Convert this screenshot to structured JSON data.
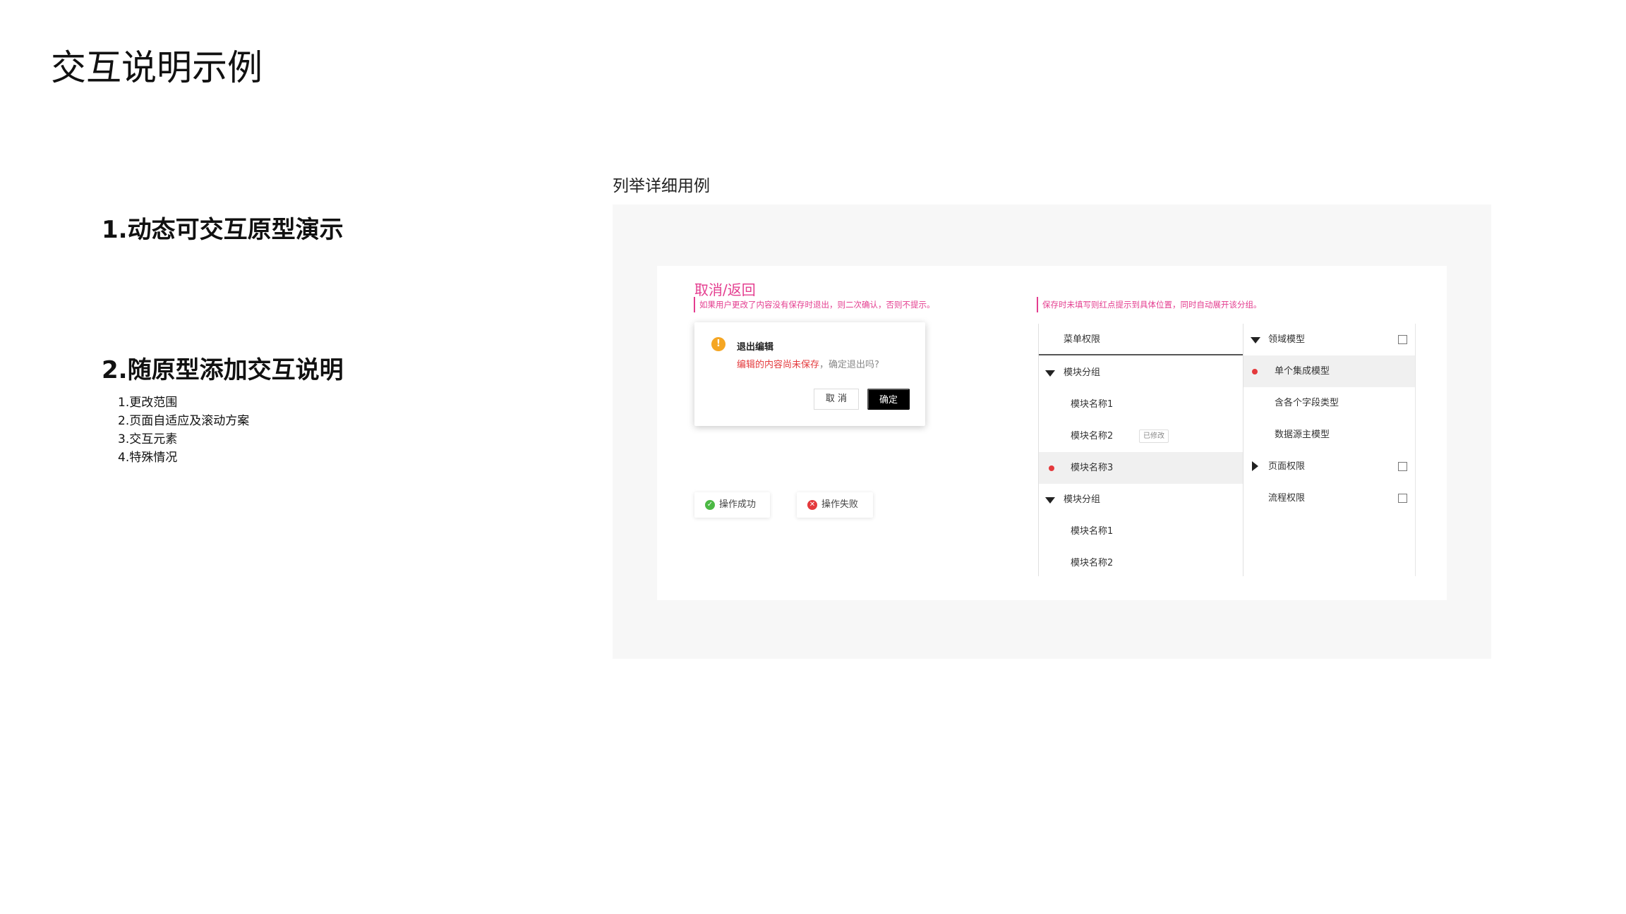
{
  "page": {
    "title": "交互说明示例"
  },
  "sections": {
    "s1": {
      "title": "1.动态可交互原型演示"
    },
    "s2": {
      "title": "2.随原型添加交互说明",
      "items": [
        "1.更改范围",
        "2.页面自适应及滚动方案",
        "3.交互元素",
        "4.特殊情况"
      ]
    }
  },
  "example": {
    "label": "列举详细用例",
    "annotation_title": "取消/返回",
    "note_left": "如果用户更改了内容没有保存时退出，则二次确认，否则不提示。",
    "note_right": "保存时未填写则红点提示到具体位置，同时自动展开该分组。",
    "dialog": {
      "icon": "!",
      "title": "退出编辑",
      "message_red": "编辑的内容尚未保存",
      "message_gray": "，确定退出吗?",
      "cancel_label": "取 消",
      "ok_label": "确定"
    },
    "toasts": {
      "success_label": "操作成功",
      "fail_label": "操作失败"
    },
    "tree_left": {
      "header": "菜单权限",
      "group1": "模块分组",
      "g1_item1": "模块名称1",
      "g1_item2": "模块名称2",
      "g1_item2_badge": "已修改",
      "g1_item3": "模块名称3",
      "group2": "模块分组",
      "g2_item1": "模块名称1",
      "g2_item2": "模块名称2"
    },
    "tree_right": {
      "domain_model": "领域模型",
      "single_model": "单个集成模型",
      "multi_field_type": "含各个字段类型",
      "data_source_model": "数据源主模型",
      "page_permission": "页面权限",
      "flow_permission": "流程权限"
    }
  },
  "colors": {
    "annotation": "#e43d8f",
    "error_dot": "#e4393c",
    "warning": "#f5a623",
    "success": "#4cb944"
  }
}
